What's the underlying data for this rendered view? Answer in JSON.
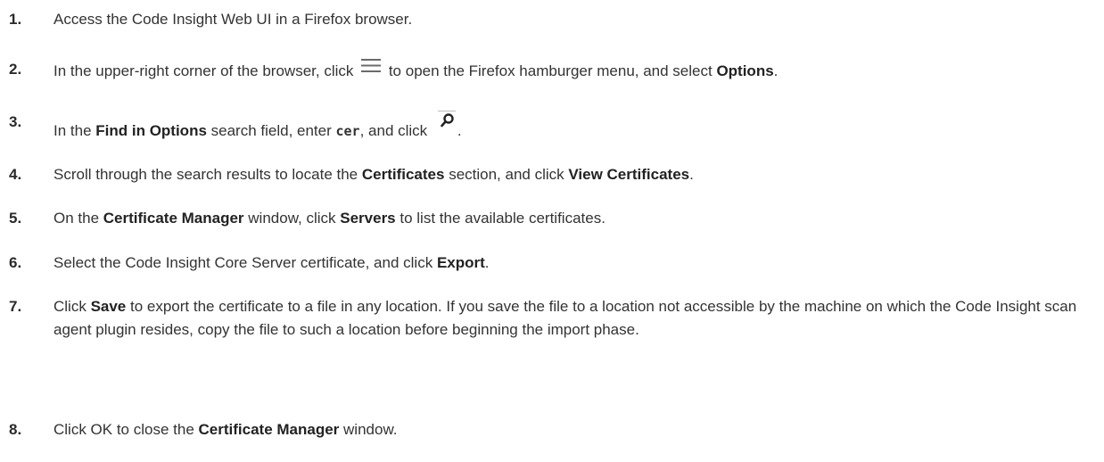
{
  "steps": [
    {
      "num": "1.",
      "t1": "Access the Code Insight Web UI in a Firefox browser."
    },
    {
      "num": "2.",
      "t1": "In the upper-right corner of the browser, click ",
      "icon": "hamburger-menu-icon",
      "t2": " to open the Firefox hamburger menu, and select ",
      "b1": "Options",
      "t3": "."
    },
    {
      "num": "3.",
      "t1": "In the ",
      "b1": "Find in Options",
      "t2": " search field, enter ",
      "code": "cer",
      "t3": ", and click ",
      "icon": "search-icon",
      "t4": "."
    },
    {
      "num": "4.",
      "t1": "Scroll through the search results to locate the ",
      "b1": "Certificates",
      "t2": " section, and click ",
      "b2": "View Certificates",
      "t3": "."
    },
    {
      "num": "5.",
      "t1": "On the ",
      "b1": "Certificate Manager",
      "t2": " window, click ",
      "b2": "Servers",
      "t3": " to list the available certificates."
    },
    {
      "num": "6.",
      "t1": "Select the Code Insight Core Server certificate, and click ",
      "b1": "Export",
      "t2": "."
    },
    {
      "num": "7.",
      "t1": "Click ",
      "b1": "Save",
      "t2": " to export the certificate to a file in any location. If you save the file to a location not accessible by the machine on which the Code Insight scan agent plugin resides, copy the file to such a location before beginning the import phase."
    },
    {
      "num": "8.",
      "t1": "Click OK to close the ",
      "b1": "Certificate Manager",
      "t2": " window."
    }
  ]
}
